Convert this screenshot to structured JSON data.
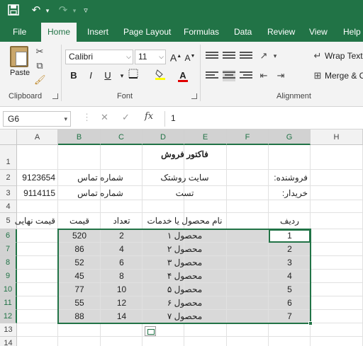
{
  "qat": {
    "save_icon": "save-icon",
    "undo_icon": "undo-icon",
    "redo_icon": "redo-icon",
    "customize_icon": "customize-qat-icon"
  },
  "tabs": [
    "File",
    "Home",
    "Insert",
    "Page Layout",
    "Formulas",
    "Data",
    "Review",
    "View",
    "Help"
  ],
  "ribbon": {
    "clipboard": {
      "label": "Clipboard",
      "paste_label": "Paste"
    },
    "font": {
      "label": "Font",
      "name": "Calibri",
      "size": "11",
      "bold": "B",
      "italic": "I",
      "underline": "U",
      "font_color_glyph": "A"
    },
    "alignment": {
      "label": "Alignment",
      "wrap_text": "Wrap Text",
      "merge": "Merge & C"
    }
  },
  "formula_bar": {
    "name_box": "G6",
    "cancel": "✕",
    "enter": "✓",
    "fx": "fx",
    "value": "1"
  },
  "columns": [
    "A",
    "B",
    "C",
    "D",
    "E",
    "F",
    "G",
    "H"
  ],
  "rows": [
    "1",
    "2",
    "3",
    "4",
    "5",
    "6",
    "7",
    "8",
    "9",
    "10",
    "11",
    "12",
    "13",
    "14"
  ],
  "sheet": {
    "title": "فاکتور فروش",
    "seller_label": "فروشنده:",
    "seller_value": "سایت روشتک",
    "buyer_label": "خریدار:",
    "buyer_value": "تست",
    "contact_label": "شماره تماس",
    "contact_label_2": "شماره تماس",
    "phone_1": "9123654",
    "phone_2": "9114115",
    "headers": {
      "row": "ردیف",
      "product": "نام محصول یا خدمات",
      "qty": "تعداد",
      "price": "قیمت",
      "final_price": "قیمت نهایی"
    },
    "items": [
      {
        "row": "1",
        "product": "محصول ۱",
        "qty": "2",
        "price": "520"
      },
      {
        "row": "2",
        "product": "محصول ۲",
        "qty": "4",
        "price": "86"
      },
      {
        "row": "3",
        "product": "محصول ۳",
        "qty": "6",
        "price": "52"
      },
      {
        "row": "4",
        "product": "محصول ۴",
        "qty": "8",
        "price": "45"
      },
      {
        "row": "5",
        "product": "محصول ۵",
        "qty": "10",
        "price": "77"
      },
      {
        "row": "6",
        "product": "محصول ۶",
        "qty": "12",
        "price": "55"
      },
      {
        "row": "7",
        "product": "محصول ۷",
        "qty": "14",
        "price": "88"
      }
    ]
  },
  "colors": {
    "accent": "#217346",
    "selection_fill": "#d9d9d9"
  }
}
